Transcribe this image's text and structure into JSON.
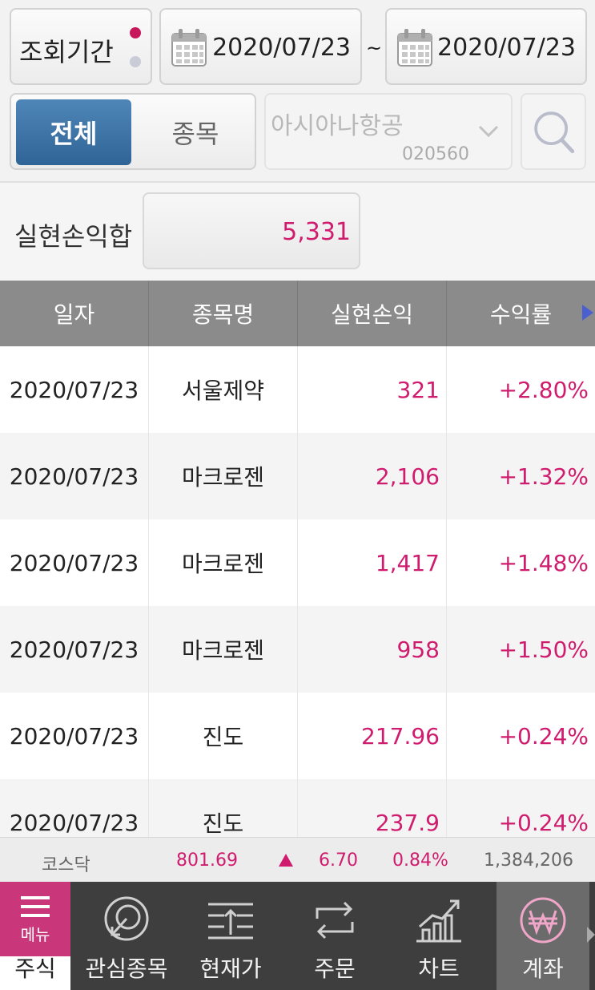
{
  "query": {
    "period_label": "조회기간",
    "date_from": "2020/07/23",
    "date_separator": "~",
    "date_to": "2020/07/23"
  },
  "filter": {
    "segments": [
      "전체",
      "종목"
    ],
    "active_segment": "전체",
    "stock_name": "아시아나항공",
    "stock_code": "020560"
  },
  "summary": {
    "label": "실현손익합",
    "value": "5,331"
  },
  "table": {
    "columns": [
      "일자",
      "종목명",
      "실현손익",
      "수익률"
    ],
    "rows": [
      {
        "date": "2020/07/23",
        "name": "서울제약",
        "pl": "321",
        "rate": "+2.80%"
      },
      {
        "date": "2020/07/23",
        "name": "마크로젠",
        "pl": "2,106",
        "rate": "+1.32%"
      },
      {
        "date": "2020/07/23",
        "name": "마크로젠",
        "pl": "1,417",
        "rate": "+1.48%"
      },
      {
        "date": "2020/07/23",
        "name": "마크로젠",
        "pl": "958",
        "rate": "+1.50%"
      },
      {
        "date": "2020/07/23",
        "name": "진도",
        "pl": "217.96",
        "rate": "+0.24%"
      },
      {
        "date": "2020/07/23",
        "name": "진도",
        "pl": "237.9",
        "rate": "+0.24%"
      }
    ]
  },
  "ticker": {
    "index_name": "코스닥",
    "value": "801.69",
    "direction_icon": "up-triangle-icon",
    "change": "6.70",
    "change_pct": "0.84%",
    "volume": "1,384,206"
  },
  "nav": {
    "menu_label": "메뉴",
    "menu_section": "주식",
    "items": [
      {
        "label": "관심종목",
        "icon": "watchlist-icon"
      },
      {
        "label": "현재가",
        "icon": "price-icon"
      },
      {
        "label": "주문",
        "icon": "order-icon"
      },
      {
        "label": "차트",
        "icon": "chart-icon"
      },
      {
        "label": "계좌",
        "icon": "account-won-icon"
      }
    ],
    "active": "계좌"
  },
  "colors": {
    "accent_pink": "#d01c6e",
    "segment_blue": "#2f6496",
    "header_gray": "#8b8b8b",
    "nav_dark": "#3e3e3e"
  }
}
